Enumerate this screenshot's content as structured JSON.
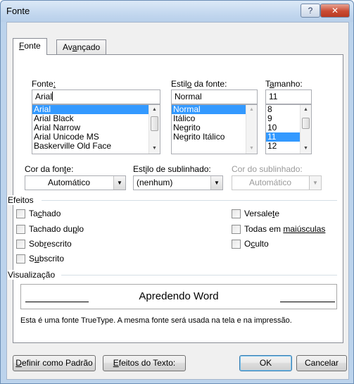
{
  "window": {
    "title": "Fonte",
    "help_glyph": "?",
    "close_glyph": "✕"
  },
  "tabs": [
    {
      "pre": "",
      "key": "F",
      "post": "onte",
      "active": true
    },
    {
      "pre": "Av",
      "key": "a",
      "post": "nçado",
      "active": false
    }
  ],
  "font": {
    "label": {
      "pre": "Fonte",
      "key": ":",
      "post": ""
    },
    "value": "Arial",
    "items": [
      "Arial",
      "Arial Black",
      "Arial Narrow",
      "Arial Unicode MS",
      "Baskerville Old Face"
    ],
    "selected_index": 0
  },
  "style": {
    "label": {
      "pre": "Estil",
      "key": "o",
      "post": " da fonte:"
    },
    "value": "Normal",
    "items": [
      "Normal",
      "Itálico",
      "Negrito",
      "Negrito Itálico"
    ],
    "selected_index": 0
  },
  "size": {
    "label": {
      "pre": "T",
      "key": "a",
      "post": "manho:"
    },
    "value": "11",
    "items": [
      "8",
      "9",
      "10",
      "11",
      "12"
    ],
    "selected_index": 3
  },
  "color": {
    "label": {
      "pre": "Cor da fon",
      "key": "t",
      "post": "e:"
    },
    "value": "Automático"
  },
  "underline_style": {
    "label": {
      "pre": "Est",
      "key": "i",
      "post": "lo de sublinhado:"
    },
    "value": "(nenhum)"
  },
  "underline_color": {
    "label": "Cor do sublinhado:",
    "value": "Automático"
  },
  "effects": {
    "title": "Efeitos",
    "left": [
      {
        "pre": "Ta",
        "key": "c",
        "post": "hado"
      },
      {
        "pre": "Tachado du",
        "key": "p",
        "post": "lo"
      },
      {
        "pre": "Sob",
        "key": "r",
        "post": "escrito"
      },
      {
        "pre": "S",
        "key": "u",
        "post": "bscrito"
      }
    ],
    "right": [
      {
        "pre": "Versale",
        "key": "t",
        "post": "e"
      },
      {
        "pre": "Todas em ",
        "key": "maiúsculas",
        "post": ""
      },
      {
        "pre": "O",
        "key": "c",
        "post": "ulto"
      }
    ]
  },
  "preview": {
    "title": "Visualização",
    "sample": "Apredendo Word",
    "note": "Esta é uma fonte TrueType. A mesma fonte será usada na tela e na impressão."
  },
  "buttons": {
    "default": {
      "pre": "",
      "key": "D",
      "post": "efinir como Padrão"
    },
    "effects": {
      "pre": "",
      "key": "E",
      "post": "feitos do Texto:"
    },
    "ok": "OK",
    "cancel": "Cancelar"
  },
  "icons": {
    "scroll_up": "▲",
    "scroll_down": "▼",
    "dropdown": "▼"
  }
}
